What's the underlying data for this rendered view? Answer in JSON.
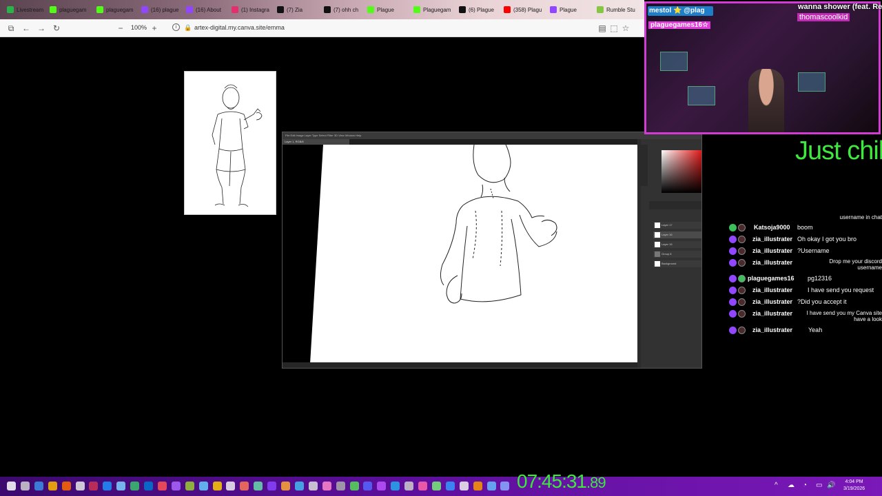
{
  "browser": {
    "tabs": [
      {
        "label": "Livestream",
        "color": "#29b34a"
      },
      {
        "label": "plaguegam",
        "color": "#53fc18"
      },
      {
        "label": "plaguegam",
        "color": "#53fc18"
      },
      {
        "label": "(16) plague",
        "color": "#9146ff"
      },
      {
        "label": "(16) About",
        "color": "#9146ff"
      },
      {
        "label": "(1) Instagra",
        "color": "#e1306c"
      },
      {
        "label": "(7) Zia",
        "color": "#111111"
      },
      {
        "label": "(7) ohh ch",
        "color": "#111111"
      },
      {
        "label": "Plague",
        "color": "#53fc18"
      },
      {
        "label": "Plaguegam",
        "color": "#53fc18"
      },
      {
        "label": "(6) Plague",
        "color": "#111111"
      },
      {
        "label": "(358) Plagu",
        "color": "#ff0000"
      },
      {
        "label": "Plague",
        "color": "#9146ff"
      },
      {
        "label": "Rumble Stu",
        "color": "#85c742"
      }
    ],
    "zoom": "100%",
    "url": "artex-digital.my.canva.site/emma"
  },
  "photoshop": {
    "doc_tab": "Layer 1, RGB/8",
    "layers": [
      "Layer 17",
      "Layer 16",
      "Layer 15",
      "Group 8",
      "Background"
    ]
  },
  "stream": {
    "song_title": "wanna shower (feat. Rei",
    "song_artist": "thomascoolkid",
    "handle_top": "mestol ⭐ @plag",
    "handle_bottom": "plaguegames16☆",
    "headline": "Just chil",
    "timer_main": "07:45:31",
    "timer_ms": ".89"
  },
  "chat": {
    "overflow_line": "username in chat",
    "messages": [
      {
        "user": "Katsoja9000",
        "text": "boom"
      },
      {
        "user": "zia_illustrater",
        "text": "Oh okay I got you bro"
      },
      {
        "user": "zia_illustrater",
        "text": "?Username"
      },
      {
        "user": "zia_illustrater",
        "text": "Drop me your discord username"
      },
      {
        "user": "plaguegames16",
        "text": "pg12316"
      },
      {
        "user": "zia_illustrater",
        "text": "I have send you request"
      },
      {
        "user": "zia_illustrater",
        "text": "?Did you accept it"
      },
      {
        "user": "zia_illustrater",
        "text": "I have send you my Canva site have a look"
      },
      {
        "user": "zia_illustrater",
        "text": "Yeah"
      }
    ]
  },
  "system": {
    "time": "4:04 PM",
    "date": "3/19/2026"
  }
}
